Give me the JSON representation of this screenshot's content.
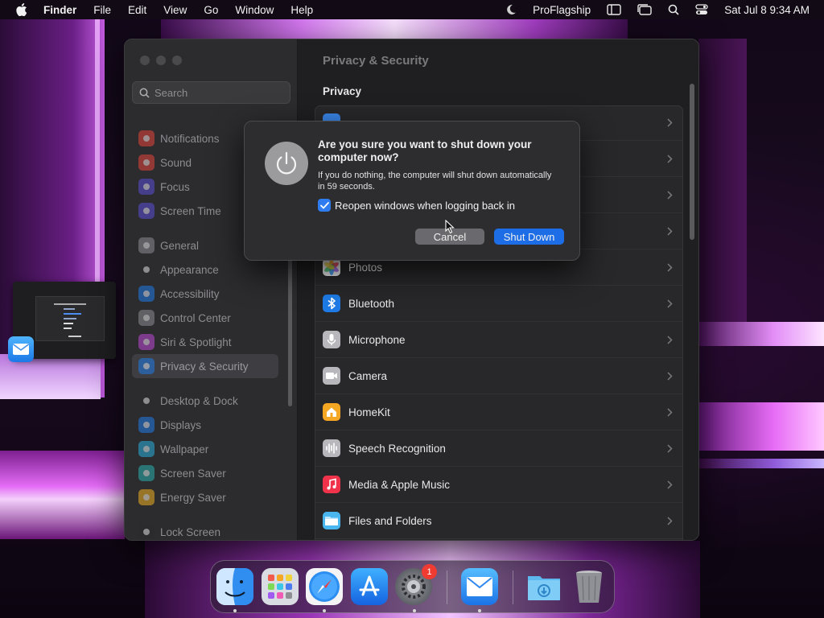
{
  "menubar": {
    "items": [
      "Finder",
      "File",
      "Edit",
      "View",
      "Go",
      "Window",
      "Help"
    ],
    "app_label": "ProFlagship",
    "datetime": "Sat Jul 8  9:34 AM"
  },
  "settings": {
    "search_placeholder": "Search",
    "content_title": "Privacy & Security",
    "section_title": "Privacy",
    "sidebar": [
      {
        "label": "Notifications",
        "icon": "bell-icon",
        "color": "#e8453c"
      },
      {
        "label": "Sound",
        "icon": "speaker-icon",
        "color": "#e8453c"
      },
      {
        "label": "Focus",
        "icon": "moon-icon",
        "color": "#5b4fd6"
      },
      {
        "label": "Screen Time",
        "icon": "hourglass-icon",
        "color": "#5b4fd6"
      },
      {
        "label": "General",
        "icon": "gear-icon",
        "color": "#8e8e93"
      },
      {
        "label": "Appearance",
        "icon": "appearance-icon",
        "color": "#2c2c2e"
      },
      {
        "label": "Accessibility",
        "icon": "accessibility-icon",
        "color": "#1e7be6"
      },
      {
        "label": "Control Center",
        "icon": "control-center-icon",
        "color": "#8e8e93"
      },
      {
        "label": "Siri & Spotlight",
        "icon": "siri-icon",
        "color": "#c04ad8"
      },
      {
        "label": "Privacy & Security",
        "icon": "hand-icon",
        "color": "#1e7be6"
      },
      {
        "label": "Desktop & Dock",
        "icon": "desktop-icon",
        "color": "#2c2c2e"
      },
      {
        "label": "Displays",
        "icon": "sun-icon",
        "color": "#1e7be6"
      },
      {
        "label": "Wallpaper",
        "icon": "wallpaper-icon",
        "color": "#2ab0e0"
      },
      {
        "label": "Screen Saver",
        "icon": "screensaver-icon",
        "color": "#2ab0b0"
      },
      {
        "label": "Energy Saver",
        "icon": "battery-icon",
        "color": "#f0b020"
      },
      {
        "label": "Lock Screen",
        "icon": "lock-icon",
        "color": "#2c2c2e"
      }
    ],
    "privacy_rows": [
      {
        "label": "Photos",
        "icon": "photos-icon"
      },
      {
        "label": "Bluetooth",
        "icon": "bluetooth-icon",
        "color": "#1e7be6"
      },
      {
        "label": "Microphone",
        "icon": "microphone-icon",
        "color": "#b8b8bc"
      },
      {
        "label": "Camera",
        "icon": "camera-icon",
        "color": "#b8b8bc"
      },
      {
        "label": "HomeKit",
        "icon": "home-icon",
        "color": "#f5a623"
      },
      {
        "label": "Speech Recognition",
        "icon": "waveform-icon",
        "color": "#b8b8bc"
      },
      {
        "label": "Media & Apple Music",
        "icon": "music-icon",
        "color": "#f0324a"
      },
      {
        "label": "Files and Folders",
        "icon": "folder-icon",
        "color": "#4ab6f0"
      }
    ]
  },
  "dialog": {
    "title": "Are you sure you want to shut down your computer now?",
    "message": "If you do nothing, the computer will shut down automatically in 59 seconds.",
    "checkbox_label": "Reopen windows when logging back in",
    "checkbox_checked": true,
    "cancel_label": "Cancel",
    "confirm_label": "Shut Down"
  },
  "dock": {
    "apps": [
      "finder-icon",
      "launchpad-icon",
      "safari-icon",
      "app-store-icon",
      "system-settings-icon",
      "mail-icon",
      "downloads-folder-icon",
      "trash-icon"
    ],
    "settings_badge": "1"
  }
}
